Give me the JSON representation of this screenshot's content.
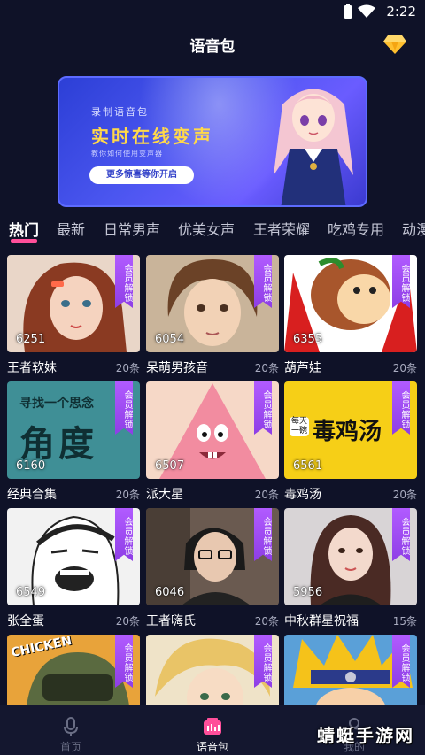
{
  "status_bar": {
    "time": "2:22"
  },
  "header": {
    "title": "语音包"
  },
  "banner": {
    "subtitle": "录制语音包",
    "headline": "实时在线变声",
    "hint": "教你如何使用变声器",
    "button": "更多惊喜等你开启"
  },
  "tabs": [
    {
      "label": "热门",
      "active": true
    },
    {
      "label": "最新"
    },
    {
      "label": "日常男声"
    },
    {
      "label": "优美女声"
    },
    {
      "label": "王者荣耀"
    },
    {
      "label": "吃鸡专用"
    },
    {
      "label": "动漫"
    }
  ],
  "badge_text": "会员解锁",
  "cards": [
    {
      "name": "王者软妹",
      "plays": "6251",
      "items": "20条"
    },
    {
      "name": "呆萌男孩音",
      "plays": "6054",
      "items": "20条"
    },
    {
      "name": "葫芦娃",
      "plays": "6355",
      "items": "20条"
    },
    {
      "name": "经典合集",
      "plays": "6160",
      "items": "20条",
      "thumb_text_small": "寻找一个思念",
      "thumb_text_big": "角度"
    },
    {
      "name": "派大星",
      "plays": "6507",
      "items": "20条"
    },
    {
      "name": "毒鸡汤",
      "plays": "6561",
      "items": "20条",
      "thumb_text_small": "每天一碗",
      "thumb_text_big": "毒鸡汤"
    },
    {
      "name": "张全蛋",
      "plays": "6549",
      "items": "20条"
    },
    {
      "name": "王者嗨氏",
      "plays": "6046",
      "items": "20条"
    },
    {
      "name": "中秋群星祝福",
      "plays": "5956",
      "items": "15条"
    },
    {
      "name": "",
      "plays": "",
      "items": "",
      "thumb_text_small": "CHICKEN"
    },
    {
      "name": "",
      "plays": "",
      "items": ""
    },
    {
      "name": "",
      "plays": "",
      "items": ""
    }
  ],
  "bottom_nav": [
    {
      "label": "首页",
      "icon": "microphone-icon"
    },
    {
      "label": "语音包",
      "icon": "voice-pack-icon",
      "active": true
    },
    {
      "label": "我的",
      "icon": "profile-icon"
    }
  ],
  "watermark": "蜻蜓手游网",
  "colors": {
    "accent": "#ff4f9a",
    "badge": "#9b47f0",
    "background": "#0f1228",
    "vip": "#ffbf2e"
  }
}
